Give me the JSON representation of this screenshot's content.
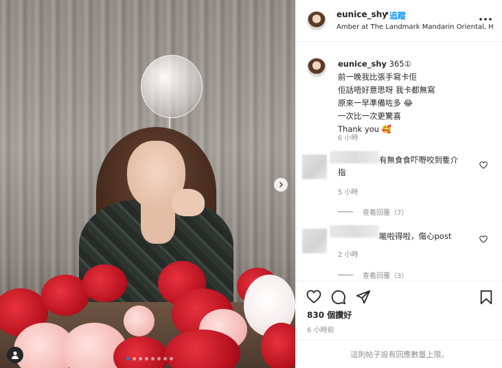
{
  "post_header": {
    "username": "eunice_shy",
    "separator": "•",
    "follow_label": "追蹤",
    "location": "Amber at The Landmark Mandarin Oriental, H...",
    "more_icon": "more-horizontal-icon"
  },
  "caption": {
    "username": "eunice_shy",
    "suffix": "365①",
    "lines": [
      "前一晚我比張手寫卡佢",
      "佢話唔好意思呀 我卡都無寫",
      "原來一早準備咗多 😂",
      "一次比一次更驚喜",
      "Thank you 🥰"
    ],
    "time": "6 小時"
  },
  "comments": [
    {
      "text_line1": "有無食食吓嘢咬到隻介",
      "text_line2": "指",
      "time": "5 小時",
      "view_replies": "查看回覆（7）"
    },
    {
      "text_line1": "𠹌啦得啦，傷心post",
      "time": "2 小時",
      "view_replies": "查看回覆（3）"
    }
  ],
  "actions": {
    "like_icon": "heart-icon",
    "comment_icon": "comment-icon",
    "share_icon": "send-icon",
    "save_icon": "bookmark-icon"
  },
  "likes": "830 個讚好",
  "post_time": "6 小時前",
  "footer_note": "這則帖子設有回應數量上限。",
  "colors": {
    "accent": "#0095f6",
    "text": "#262626",
    "muted": "#8e8e8e",
    "border": "#efefef"
  }
}
